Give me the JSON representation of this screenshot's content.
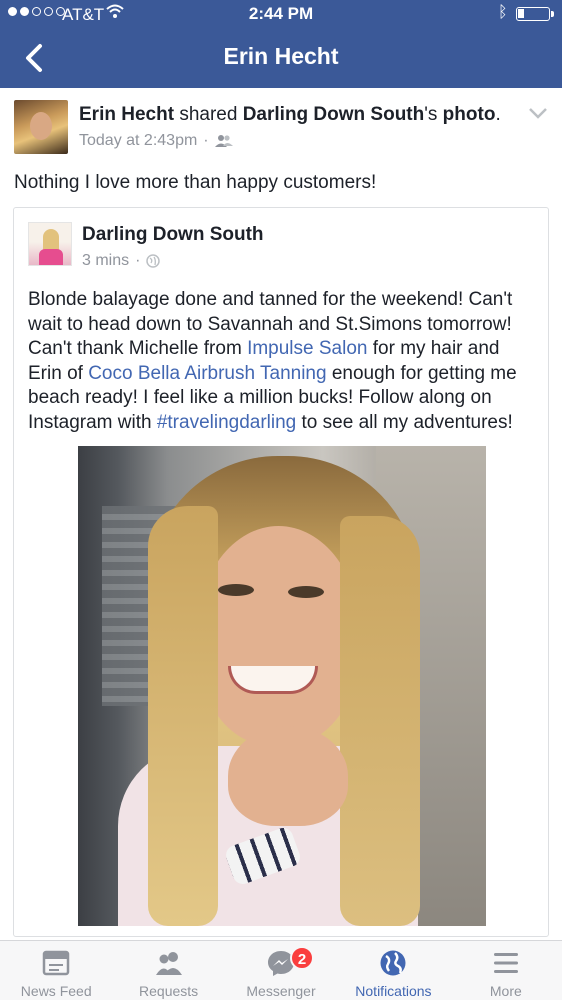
{
  "status_bar": {
    "carrier": "AT&T",
    "time": "2:44 PM",
    "signal_bars_filled": 2,
    "signal_bars_total": 5
  },
  "nav": {
    "title": "Erin Hecht",
    "back_icon": "chevron-left-icon"
  },
  "post": {
    "author": "Erin Hecht",
    "action": "shared",
    "source": "Darling Down South",
    "possessive": "'s",
    "object": "photo",
    "period": ".",
    "time": "Today at 2:43pm",
    "separator": "·",
    "audience_icon": "friends-icon",
    "text": "Nothing I love more than happy customers!"
  },
  "shared": {
    "page_name": "Darling Down South",
    "time": "3 mins",
    "separator": "·",
    "audience_icon": "globe-icon",
    "body": {
      "p1": "Blonde balayage done and tanned for the weekend! Can't wait to head down to Savannah and St.Simons tomorrow! Can't thank Michelle from ",
      "link1": "Impulse Salon",
      "p2": " for my hair and Erin of ",
      "link2": "Coco Bella Airbrush Tanning",
      "p3": " enough for getting me beach ready! I feel like a million bucks! Follow along on Instagram with ",
      "link3": "#travelingdarling",
      "p4": " to see all my adventures!"
    }
  },
  "tabs": [
    {
      "label": "News Feed",
      "icon": "news-feed-icon",
      "active": false
    },
    {
      "label": "Requests",
      "icon": "friend-requests-icon",
      "active": false
    },
    {
      "label": "Messenger",
      "icon": "messenger-icon",
      "active": false,
      "badge": "2"
    },
    {
      "label": "Notifications",
      "icon": "globe-icon",
      "active": true
    },
    {
      "label": "More",
      "icon": "menu-icon",
      "active": false
    }
  ],
  "colors": {
    "brand": "#3b5998",
    "link": "#4267b2",
    "badge": "#fa3e3e",
    "meta_text": "#90949c"
  }
}
